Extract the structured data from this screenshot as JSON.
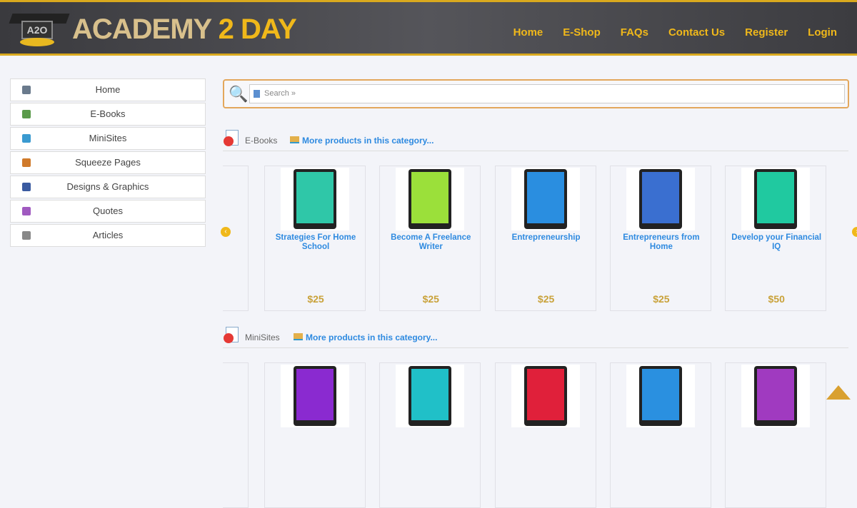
{
  "header": {
    "logo_badge": "A2O",
    "logo_word": "ACADEMY",
    "logo_num": "2",
    "logo_tail": "DAY",
    "nav": [
      "Home",
      "E-Shop",
      "FAQs",
      "Contact Us",
      "Register",
      "Login"
    ]
  },
  "sidebar": {
    "items": [
      {
        "label": "Home",
        "color": "#6a7a8c"
      },
      {
        "label": "E-Books",
        "color": "#5a9a4a"
      },
      {
        "label": "MiniSites",
        "color": "#3a9ad0"
      },
      {
        "label": "Squeeze Pages",
        "color": "#d07a2a"
      },
      {
        "label": "Designs & Graphics",
        "color": "#3a5aa0"
      },
      {
        "label": "Quotes",
        "color": "#a05ac0"
      },
      {
        "label": "Articles",
        "color": "#888888"
      }
    ]
  },
  "search": {
    "placeholder": "Search »"
  },
  "categories": [
    {
      "name": "E-Books",
      "more": "More products in this category...",
      "products": [
        {
          "title": "Strategies For Home School",
          "price": "$25",
          "color": "#2fc7a8"
        },
        {
          "title": "Become A Freelance Writer",
          "price": "$25",
          "color": "#9be03a"
        },
        {
          "title": "Entrepreneurship",
          "price": "$25",
          "color": "#2a8ee0"
        },
        {
          "title": "Entrepreneurs from Home",
          "price": "$25",
          "color": "#3a6fd0"
        },
        {
          "title": "Develop your Financial IQ",
          "price": "$50",
          "color": "#20c9a0"
        }
      ]
    },
    {
      "name": "MiniSites",
      "more": "More products in this category...",
      "products": [
        {
          "color": "#8a2ad0"
        },
        {
          "color": "#20c0c8"
        },
        {
          "color": "#e0203a"
        },
        {
          "color": "#2a90e0"
        },
        {
          "color": "#a03ac0"
        }
      ]
    }
  ]
}
